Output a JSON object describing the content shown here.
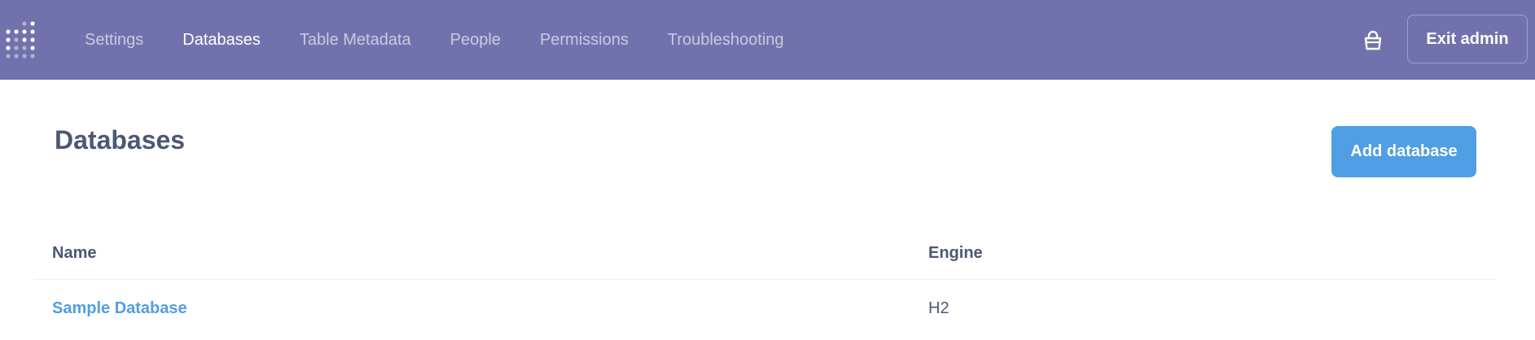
{
  "navbar": {
    "background": "#7172ad",
    "logo_icon": "metabase-logo-icon",
    "items": [
      {
        "label": "Settings",
        "active": false
      },
      {
        "label": "Databases",
        "active": true
      },
      {
        "label": "Table Metadata",
        "active": false
      },
      {
        "label": "People",
        "active": false
      },
      {
        "label": "Permissions",
        "active": false
      },
      {
        "label": "Troubleshooting",
        "active": false
      }
    ],
    "store_icon": "store-bag-icon",
    "exit_label": "Exit admin"
  },
  "main": {
    "title": "Databases",
    "add_button_label": "Add database",
    "accent": "#509ee3",
    "table": {
      "columns": [
        "Name",
        "Engine"
      ],
      "rows": [
        {
          "name": "Sample Database",
          "engine": "H2"
        }
      ]
    }
  }
}
